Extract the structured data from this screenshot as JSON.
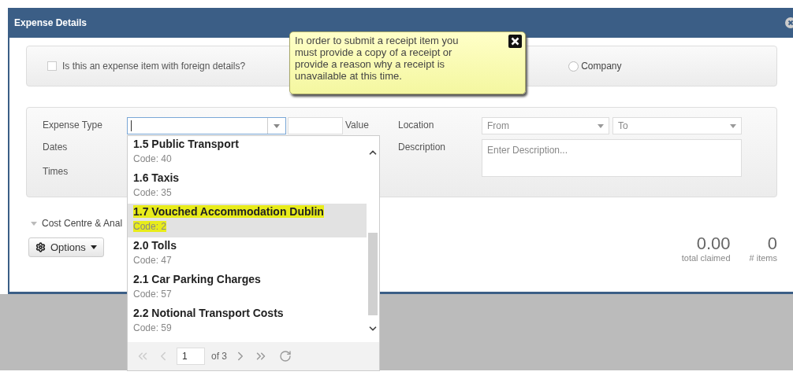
{
  "dialog": {
    "title": "Expense Details"
  },
  "foreign_details": {
    "label": "Is this an expense item with foreign details?",
    "checked": false
  },
  "payment": {
    "options": [
      {
        "label": "Company",
        "selected": false
      }
    ]
  },
  "expense_type": {
    "label": "Expense Type"
  },
  "value": {
    "label": "Value"
  },
  "dates": {
    "label": "Dates"
  },
  "times": {
    "label": "Times"
  },
  "location": {
    "label": "Location",
    "from": {
      "placeholder": "From"
    },
    "to": {
      "placeholder": "To"
    }
  },
  "description": {
    "label": "Description",
    "placeholder": "Enter Description..."
  },
  "cost_centre": {
    "label": "Cost Centre & Anal"
  },
  "options_button": {
    "label": "Options"
  },
  "totals": [
    {
      "value": "0.00",
      "caption": "total claimed"
    },
    {
      "value": "0",
      "caption": "# items"
    }
  ],
  "dropdown": {
    "items": [
      {
        "name": "1.5 Public Transport",
        "code": "Code: 40",
        "selected": false,
        "highlighted": false
      },
      {
        "name": "1.6 Taxis",
        "code": "Code: 35",
        "selected": false,
        "highlighted": false
      },
      {
        "name": "1.7 Vouched Accommodation Dublin",
        "code": "Code: 2",
        "selected": true,
        "highlighted": true
      },
      {
        "name": "2.0 Tolls",
        "code": "Code: 47",
        "selected": false,
        "highlighted": false
      },
      {
        "name": "2.1 Car Parking Charges",
        "code": "Code: 57",
        "selected": false,
        "highlighted": false
      },
      {
        "name": "2.2 Notional Transport Costs",
        "code": "Code: 59",
        "selected": false,
        "highlighted": false
      }
    ],
    "pager": {
      "page": "1",
      "total": "of 3"
    }
  },
  "tooltip": {
    "text": "In order to submit a receipt item you must provide a copy of a receipt or provide a reason why a receipt is unavailable at this time."
  }
}
